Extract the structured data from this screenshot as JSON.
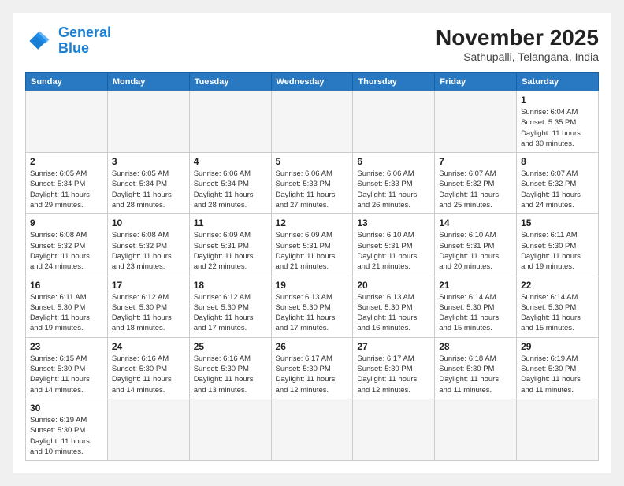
{
  "logo": {
    "line1": "General",
    "line2": "Blue"
  },
  "title": "November 2025",
  "subtitle": "Sathupalli, Telangana, India",
  "weekdays": [
    "Sunday",
    "Monday",
    "Tuesday",
    "Wednesday",
    "Thursday",
    "Friday",
    "Saturday"
  ],
  "weeks": [
    [
      {
        "day": "",
        "info": ""
      },
      {
        "day": "",
        "info": ""
      },
      {
        "day": "",
        "info": ""
      },
      {
        "day": "",
        "info": ""
      },
      {
        "day": "",
        "info": ""
      },
      {
        "day": "",
        "info": ""
      },
      {
        "day": "1",
        "info": "Sunrise: 6:04 AM\nSunset: 5:35 PM\nDaylight: 11 hours\nand 30 minutes."
      }
    ],
    [
      {
        "day": "2",
        "info": "Sunrise: 6:05 AM\nSunset: 5:34 PM\nDaylight: 11 hours\nand 29 minutes."
      },
      {
        "day": "3",
        "info": "Sunrise: 6:05 AM\nSunset: 5:34 PM\nDaylight: 11 hours\nand 28 minutes."
      },
      {
        "day": "4",
        "info": "Sunrise: 6:06 AM\nSunset: 5:34 PM\nDaylight: 11 hours\nand 28 minutes."
      },
      {
        "day": "5",
        "info": "Sunrise: 6:06 AM\nSunset: 5:33 PM\nDaylight: 11 hours\nand 27 minutes."
      },
      {
        "day": "6",
        "info": "Sunrise: 6:06 AM\nSunset: 5:33 PM\nDaylight: 11 hours\nand 26 minutes."
      },
      {
        "day": "7",
        "info": "Sunrise: 6:07 AM\nSunset: 5:32 PM\nDaylight: 11 hours\nand 25 minutes."
      },
      {
        "day": "8",
        "info": "Sunrise: 6:07 AM\nSunset: 5:32 PM\nDaylight: 11 hours\nand 24 minutes."
      }
    ],
    [
      {
        "day": "9",
        "info": "Sunrise: 6:08 AM\nSunset: 5:32 PM\nDaylight: 11 hours\nand 24 minutes."
      },
      {
        "day": "10",
        "info": "Sunrise: 6:08 AM\nSunset: 5:32 PM\nDaylight: 11 hours\nand 23 minutes."
      },
      {
        "day": "11",
        "info": "Sunrise: 6:09 AM\nSunset: 5:31 PM\nDaylight: 11 hours\nand 22 minutes."
      },
      {
        "day": "12",
        "info": "Sunrise: 6:09 AM\nSunset: 5:31 PM\nDaylight: 11 hours\nand 21 minutes."
      },
      {
        "day": "13",
        "info": "Sunrise: 6:10 AM\nSunset: 5:31 PM\nDaylight: 11 hours\nand 21 minutes."
      },
      {
        "day": "14",
        "info": "Sunrise: 6:10 AM\nSunset: 5:31 PM\nDaylight: 11 hours\nand 20 minutes."
      },
      {
        "day": "15",
        "info": "Sunrise: 6:11 AM\nSunset: 5:30 PM\nDaylight: 11 hours\nand 19 minutes."
      }
    ],
    [
      {
        "day": "16",
        "info": "Sunrise: 6:11 AM\nSunset: 5:30 PM\nDaylight: 11 hours\nand 19 minutes."
      },
      {
        "day": "17",
        "info": "Sunrise: 6:12 AM\nSunset: 5:30 PM\nDaylight: 11 hours\nand 18 minutes."
      },
      {
        "day": "18",
        "info": "Sunrise: 6:12 AM\nSunset: 5:30 PM\nDaylight: 11 hours\nand 17 minutes."
      },
      {
        "day": "19",
        "info": "Sunrise: 6:13 AM\nSunset: 5:30 PM\nDaylight: 11 hours\nand 17 minutes."
      },
      {
        "day": "20",
        "info": "Sunrise: 6:13 AM\nSunset: 5:30 PM\nDaylight: 11 hours\nand 16 minutes."
      },
      {
        "day": "21",
        "info": "Sunrise: 6:14 AM\nSunset: 5:30 PM\nDaylight: 11 hours\nand 15 minutes."
      },
      {
        "day": "22",
        "info": "Sunrise: 6:14 AM\nSunset: 5:30 PM\nDaylight: 11 hours\nand 15 minutes."
      }
    ],
    [
      {
        "day": "23",
        "info": "Sunrise: 6:15 AM\nSunset: 5:30 PM\nDaylight: 11 hours\nand 14 minutes."
      },
      {
        "day": "24",
        "info": "Sunrise: 6:16 AM\nSunset: 5:30 PM\nDaylight: 11 hours\nand 14 minutes."
      },
      {
        "day": "25",
        "info": "Sunrise: 6:16 AM\nSunset: 5:30 PM\nDaylight: 11 hours\nand 13 minutes."
      },
      {
        "day": "26",
        "info": "Sunrise: 6:17 AM\nSunset: 5:30 PM\nDaylight: 11 hours\nand 12 minutes."
      },
      {
        "day": "27",
        "info": "Sunrise: 6:17 AM\nSunset: 5:30 PM\nDaylight: 11 hours\nand 12 minutes."
      },
      {
        "day": "28",
        "info": "Sunrise: 6:18 AM\nSunset: 5:30 PM\nDaylight: 11 hours\nand 11 minutes."
      },
      {
        "day": "29",
        "info": "Sunrise: 6:19 AM\nSunset: 5:30 PM\nDaylight: 11 hours\nand 11 minutes."
      }
    ],
    [
      {
        "day": "30",
        "info": "Sunrise: 6:19 AM\nSunset: 5:30 PM\nDaylight: 11 hours\nand 10 minutes."
      },
      {
        "day": "",
        "info": ""
      },
      {
        "day": "",
        "info": ""
      },
      {
        "day": "",
        "info": ""
      },
      {
        "day": "",
        "info": ""
      },
      {
        "day": "",
        "info": ""
      },
      {
        "day": "",
        "info": ""
      }
    ]
  ]
}
